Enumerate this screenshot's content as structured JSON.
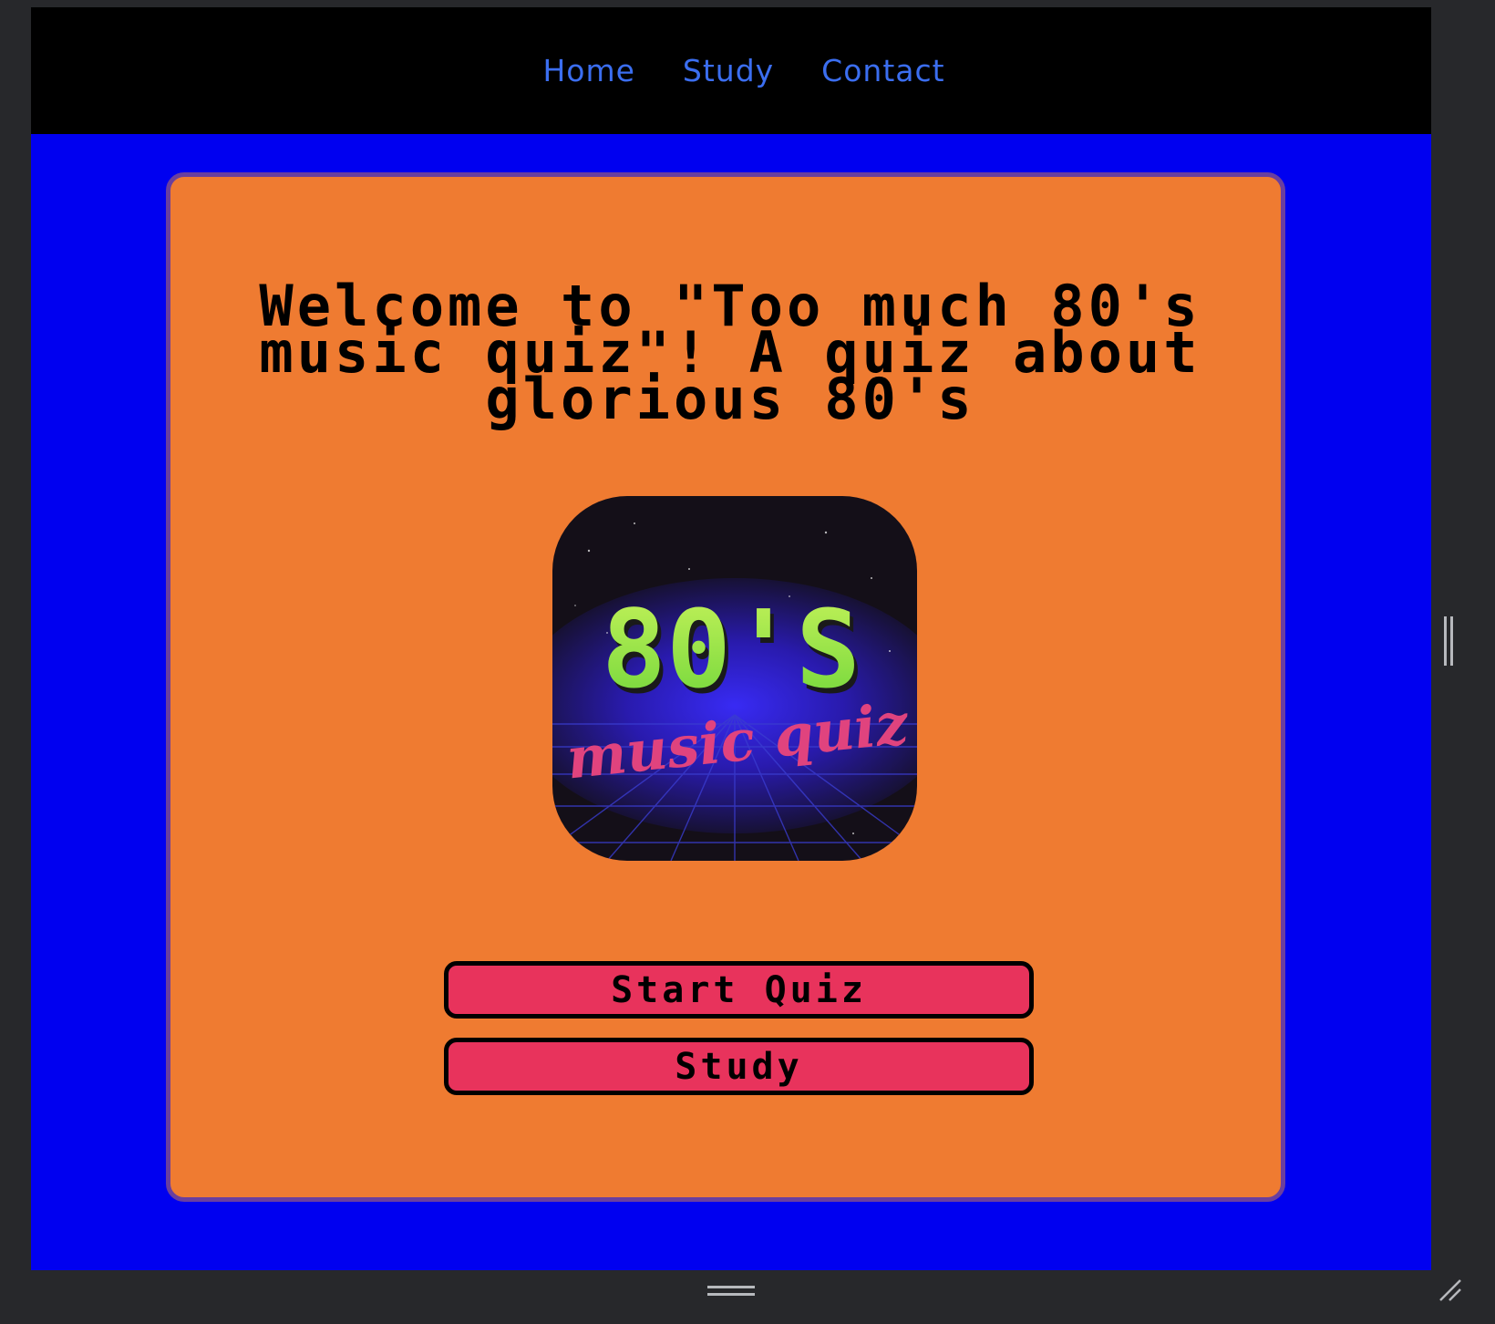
{
  "nav": {
    "links": [
      {
        "label": "Home"
      },
      {
        "label": "Study"
      },
      {
        "label": "Contact"
      }
    ]
  },
  "main": {
    "title": "Welcome to \"Too much 80's music quiz\"! A quiz about glorious 80's",
    "logo": {
      "main_text": "80'S",
      "script_text": "music quiz"
    },
    "buttons": {
      "start_label": "Start Quiz",
      "study_label": "Study"
    }
  },
  "colors": {
    "page_background": "#0000f0",
    "nav_background": "#000000",
    "nav_link": "#3b6ef0",
    "card_background": "#ef7b31",
    "card_border": "#6a3f9e",
    "button_fill": "#e8335c",
    "logo_green": "#9be84a",
    "logo_pink": "#e0437e"
  }
}
